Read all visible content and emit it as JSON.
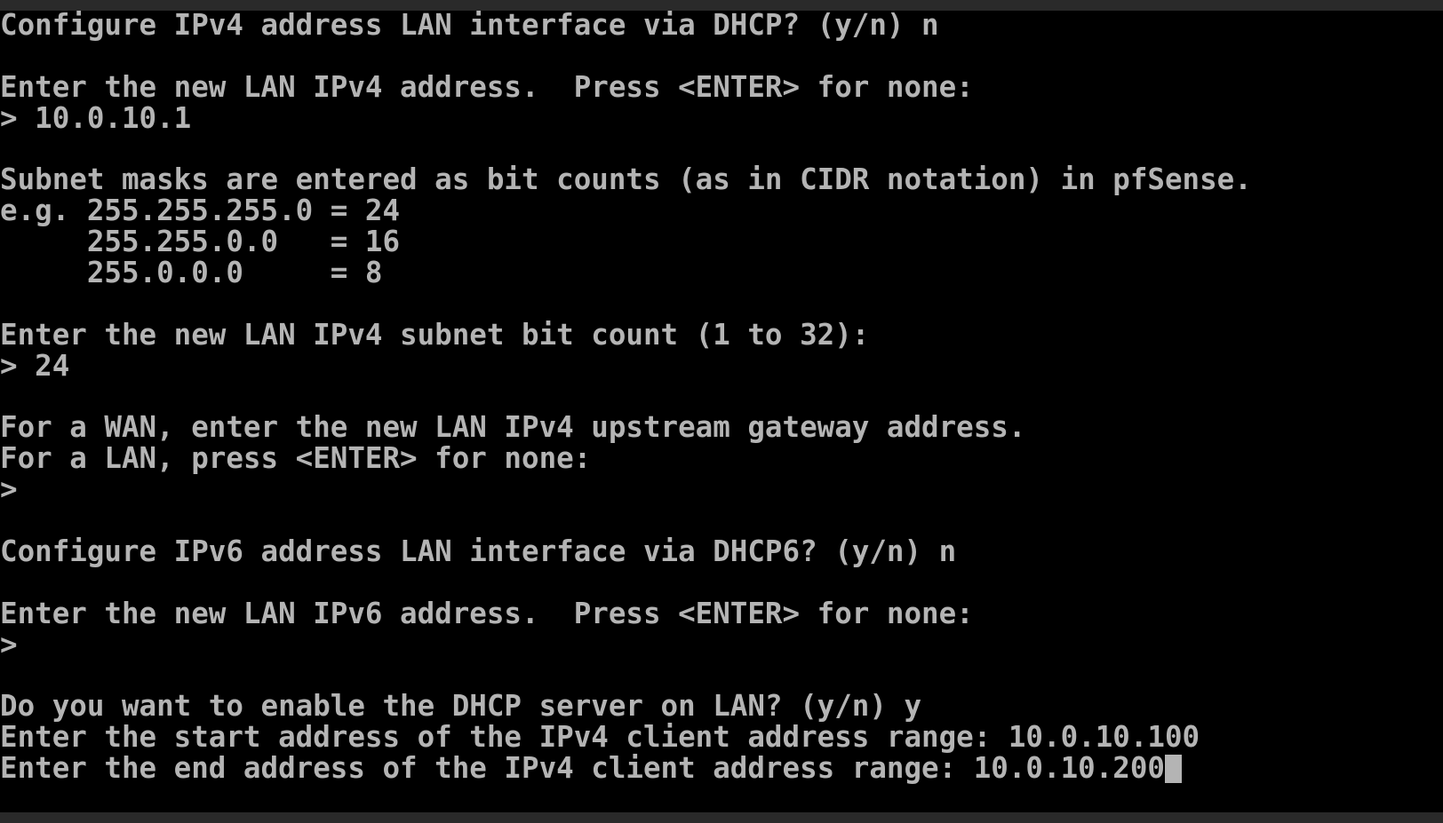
{
  "terminal": {
    "lines": [
      "Configure IPv4 address LAN interface via DHCP? (y/n) n",
      "",
      "Enter the new LAN IPv4 address.  Press <ENTER> for none:",
      "> 10.0.10.1",
      "",
      "Subnet masks are entered as bit counts (as in CIDR notation) in pfSense.",
      "e.g. 255.255.255.0 = 24",
      "     255.255.0.0   = 16",
      "     255.0.0.0     = 8",
      "",
      "Enter the new LAN IPv4 subnet bit count (1 to 32):",
      "> 24",
      "",
      "For a WAN, enter the new LAN IPv4 upstream gateway address.",
      "For a LAN, press <ENTER> for none:",
      ">",
      "",
      "Configure IPv6 address LAN interface via DHCP6? (y/n) n",
      "",
      "Enter the new LAN IPv6 address.  Press <ENTER> for none:",
      ">",
      "",
      "Do you want to enable the DHCP server on LAN? (y/n) y",
      "Enter the start address of the IPv4 client address range: 10.0.10.100",
      "Enter the end address of the IPv4 client address range: 10.0.10.200"
    ]
  },
  "colors": {
    "text": "#b4b4b4",
    "background": "#000000",
    "frame": "#2a2a2a"
  }
}
